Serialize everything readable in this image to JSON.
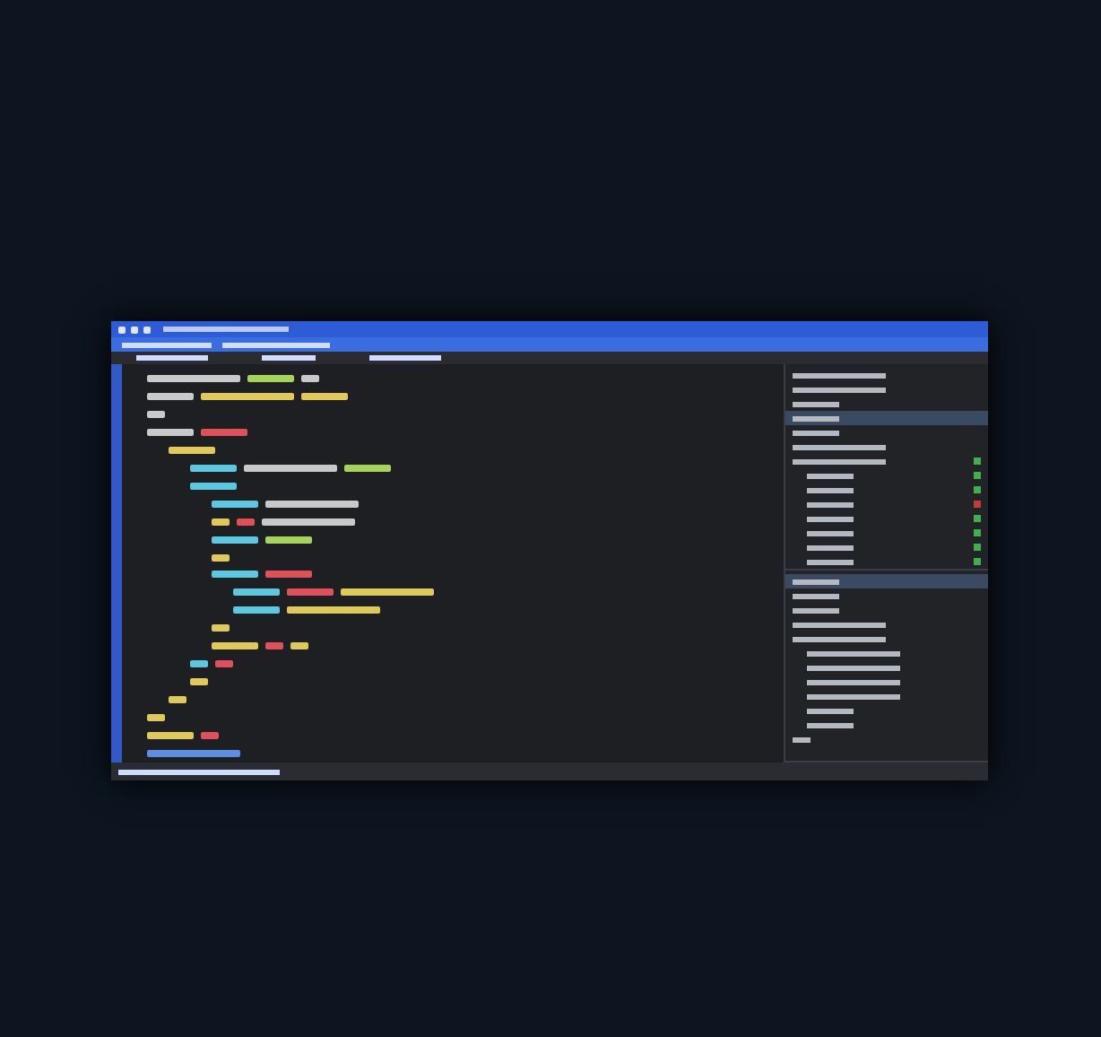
{
  "editor": {
    "lines": [
      {
        "tokens": [
          {
            "kind": "long",
            "color": "#c9c9c9"
          },
          {
            "kind": "word",
            "color": "#a6d35a"
          },
          {
            "kind": "short",
            "color": "#c9c9c9"
          }
        ]
      },
      {
        "tokens": [
          {
            "kind": "word",
            "color": "#c9c9c9"
          },
          {
            "kind": "long",
            "color": "#e0c95a"
          },
          {
            "kind": "word",
            "color": "#e0c95a"
          }
        ]
      },
      {
        "tokens": [
          {
            "kind": "short",
            "color": "#c9c9c9"
          }
        ]
      },
      {
        "tokens": [
          {
            "kind": "word",
            "color": "#c9c9c9"
          },
          {
            "kind": "word",
            "color": "#e0505a"
          }
        ],
        "children": [
          {
            "tokens": [
              {
                "kind": "word",
                "color": "#e0c95a"
              }
            ],
            "children": [
              {
                "tokens": [
                  {
                    "kind": "word",
                    "color": "#5cc8e0"
                  },
                  {
                    "kind": "long",
                    "color": "#c9c9c9"
                  },
                  {
                    "kind": "word",
                    "color": "#a6d35a"
                  }
                ]
              },
              {
                "tokens": [
                  {
                    "kind": "word",
                    "color": "#5cc8e0"
                  }
                ],
                "children": [
                  {
                    "tokens": [
                      {
                        "kind": "word",
                        "color": "#5cc8e0"
                      },
                      {
                        "kind": "long",
                        "color": "#c9c9c9"
                      }
                    ]
                  },
                  {
                    "tokens": [
                      {
                        "kind": "short",
                        "color": "#e0c95a"
                      },
                      {
                        "kind": "short",
                        "color": "#e0505a"
                      },
                      {
                        "kind": "long",
                        "color": "#c9c9c9"
                      }
                    ]
                  },
                  {
                    "tokens": [
                      {
                        "kind": "word",
                        "color": "#5cc8e0"
                      },
                      {
                        "kind": "word",
                        "color": "#a6d35a"
                      }
                    ]
                  },
                  {
                    "tokens": [
                      {
                        "kind": "short",
                        "color": "#e0c95a"
                      }
                    ]
                  },
                  {
                    "tokens": [
                      {
                        "kind": "word",
                        "color": "#5cc8e0"
                      },
                      {
                        "kind": "word",
                        "color": "#e0505a"
                      }
                    ],
                    "children": [
                      {
                        "tokens": [
                          {
                            "kind": "word",
                            "color": "#5cc8e0"
                          },
                          {
                            "kind": "word",
                            "color": "#e0505a"
                          },
                          {
                            "kind": "long",
                            "color": "#e0c95a"
                          }
                        ]
                      },
                      {
                        "tokens": [
                          {
                            "kind": "word",
                            "color": "#5cc8e0"
                          },
                          {
                            "kind": "long",
                            "color": "#e0c95a"
                          }
                        ]
                      }
                    ]
                  },
                  {
                    "tokens": [
                      {
                        "kind": "short",
                        "color": "#e0c95a"
                      }
                    ]
                  },
                  {
                    "tokens": [
                      {
                        "kind": "word",
                        "color": "#e0c95a"
                      },
                      {
                        "kind": "short",
                        "color": "#e0505a"
                      },
                      {
                        "kind": "short",
                        "color": "#e0c95a"
                      }
                    ]
                  }
                ]
              },
              {
                "tokens": [
                  {
                    "kind": "short",
                    "color": "#5cc8e0"
                  },
                  {
                    "kind": "short",
                    "color": "#e0505a"
                  }
                ]
              },
              {
                "tokens": [
                  {
                    "kind": "short",
                    "color": "#e0c95a"
                  }
                ]
              }
            ]
          },
          {
            "tokens": [
              {
                "kind": "short",
                "color": "#e0c95a"
              }
            ]
          }
        ]
      },
      {
        "tokens": [
          {
            "kind": "short",
            "color": "#e0c95a"
          }
        ]
      },
      {
        "tokens": [
          {
            "kind": "word",
            "color": "#e0c95a"
          },
          {
            "kind": "short",
            "color": "#e0505a"
          }
        ]
      },
      {
        "tokens": [
          {
            "kind": "long",
            "color": "#5c8fe0"
          }
        ]
      }
    ]
  },
  "panels": [
    {
      "rows": [
        {
          "selected": false,
          "kind": "long"
        },
        {
          "selected": false,
          "kind": "long"
        },
        {
          "selected": false,
          "kind": "word"
        },
        {
          "selected": true,
          "kind": "word"
        },
        {
          "selected": false,
          "kind": "word"
        },
        {
          "selected": false,
          "kind": "long"
        },
        {
          "selected": false,
          "kind": "long",
          "color": "#3fae4f",
          "children": [
            {
              "selected": false,
              "kind": "word",
              "color": "#3fae4f"
            },
            {
              "selected": false,
              "kind": "word",
              "color": "#3fae4f"
            },
            {
              "selected": false,
              "kind": "word",
              "color": "#c23a3a"
            },
            {
              "selected": false,
              "kind": "word",
              "color": "#3fae4f"
            },
            {
              "selected": false,
              "kind": "word",
              "color": "#3fae4f"
            },
            {
              "selected": false,
              "kind": "word",
              "color": "#3fae4f"
            },
            {
              "selected": false,
              "kind": "word",
              "color": "#3fae4f"
            }
          ]
        }
      ]
    },
    {
      "rows": [
        {
          "selected": true,
          "kind": "word"
        },
        {
          "selected": false,
          "kind": "word"
        },
        {
          "selected": false,
          "kind": "word"
        },
        {
          "selected": false,
          "kind": "long"
        },
        {
          "selected": false,
          "kind": "long",
          "children": [
            {
              "selected": false,
              "kind": "long"
            },
            {
              "selected": false,
              "kind": "long"
            },
            {
              "selected": false,
              "kind": "long"
            },
            {
              "selected": false,
              "kind": "long"
            },
            {
              "selected": false,
              "kind": "word"
            },
            {
              "selected": false,
              "kind": "word"
            }
          ]
        },
        {
          "selected": false,
          "kind": "short"
        }
      ]
    }
  ]
}
